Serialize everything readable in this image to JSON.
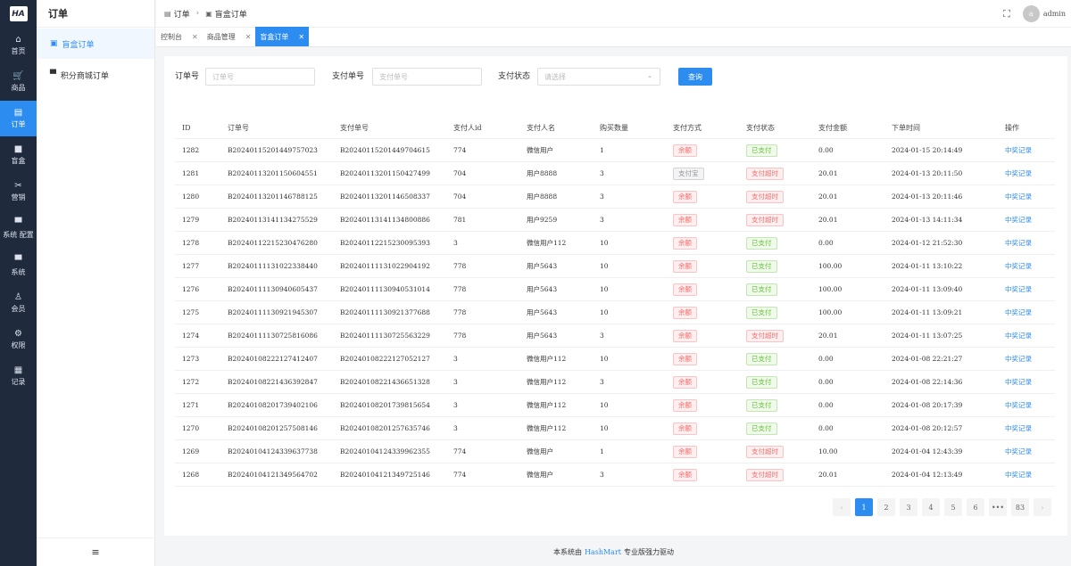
{
  "rail": {
    "logo": "HA",
    "items": [
      {
        "label": "首页",
        "icon": "home-icon",
        "glyph": "⌂"
      },
      {
        "label": "商品",
        "icon": "cart-icon",
        "glyph": "🛒"
      },
      {
        "label": "订单",
        "icon": "order-icon",
        "glyph": "▤"
      },
      {
        "label": "盲盒",
        "icon": "box-icon",
        "glyph": "■"
      },
      {
        "label": "营销",
        "icon": "marketing-icon",
        "glyph": "✂"
      },
      {
        "label": "系统 配置",
        "icon": "config-icon",
        "glyph": "▀"
      },
      {
        "label": "系统",
        "icon": "system-icon",
        "glyph": "▀"
      },
      {
        "label": "会员",
        "icon": "member-icon",
        "glyph": "♙"
      },
      {
        "label": "权限",
        "icon": "permission-icon",
        "glyph": "⚙"
      },
      {
        "label": "记录",
        "icon": "record-icon",
        "glyph": "▦"
      }
    ]
  },
  "subnav": {
    "title": "订单",
    "items": [
      {
        "label": "盲盒订单",
        "glyph": "▣"
      },
      {
        "label": "积分商城订单",
        "glyph": "▀"
      }
    ],
    "footer_glyph": "≡"
  },
  "header": {
    "crumbs": [
      "订单",
      "盲盒订单"
    ],
    "fullscreen_glyph": "⛶",
    "avatar_letter": "a",
    "username": "admin"
  },
  "tabs": [
    {
      "label": "控制台"
    },
    {
      "label": "商品管理"
    },
    {
      "label": "盲盒订单"
    }
  ],
  "filters": {
    "order_no_label": "订单号",
    "order_no_placeholder": "订单号",
    "pay_no_label": "支付单号",
    "pay_no_placeholder": "支付单号",
    "pay_status_label": "支付状态",
    "pay_status_placeholder": "请选择",
    "query_label": "查询"
  },
  "table": {
    "columns": [
      "ID",
      "订单号",
      "支付单号",
      "支付人id",
      "支付人名",
      "购买数量",
      "支付方式",
      "支付状态",
      "支付金额",
      "下单时间",
      "操作"
    ],
    "rows": [
      [
        "1282",
        "B202401152014497570​23",
        "B202401152014497046​15",
        "774",
        "微信用户",
        "1",
        "余额",
        "已支付",
        "0.00",
        "2024-01-15 20:14:49",
        "中奖记录"
      ],
      [
        "1281",
        "B202401132011506045​51",
        "B202401132011504274​99",
        "704",
        "用户8888",
        "3",
        "支付宝",
        "支付超时",
        "20.01",
        "2024-01-13 20:11:50",
        "中奖记录"
      ],
      [
        "1280",
        "B202401132011467881​25",
        "B202401132011465083​37",
        "704",
        "用户8888",
        "3",
        "余额",
        "支付超时",
        "20.01",
        "2024-01-13 20:11:46",
        "中奖记录"
      ],
      [
        "1279",
        "B202401131411342755​29",
        "B202401131411348008​86",
        "781",
        "用户9259",
        "3",
        "余额",
        "支付超时",
        "20.01",
        "2024-01-13 14:11:34",
        "中奖记录"
      ],
      [
        "1278",
        "B202401122152304762​80",
        "B202401122152300953​93",
        "3",
        "微信用户112",
        "10",
        "余额",
        "已支付",
        "0.00",
        "2024-01-12 21:52:30",
        "中奖记录"
      ],
      [
        "1277",
        "B202401111310223384​40",
        "B202401111310229041​92",
        "778",
        "用户5643",
        "10",
        "余额",
        "已支付",
        "100.00",
        "2024-01-11 13:10:22",
        "中奖记录"
      ],
      [
        "1276",
        "B202401111309406054​37",
        "B202401111309405310​14",
        "778",
        "用户5643",
        "10",
        "余额",
        "已支付",
        "100.00",
        "2024-01-11 13:09:40",
        "中奖记录"
      ],
      [
        "1275",
        "B202401111309219453​07",
        "B202401111309213776​88",
        "778",
        "用户5643",
        "10",
        "余额",
        "已支付",
        "100.00",
        "2024-01-11 13:09:21",
        "中奖记录"
      ],
      [
        "1274",
        "B202401111307258160​86",
        "B202401111307255632​29",
        "778",
        "用户5643",
        "3",
        "余额",
        "支付超时",
        "20.01",
        "2024-01-11 13:07:25",
        "中奖记录"
      ],
      [
        "1273",
        "B202401082221274124​07",
        "B202401082221270521​27",
        "3",
        "微信用户112",
        "10",
        "余额",
        "已支付",
        "0.00",
        "2024-01-08 22:21:27",
        "中奖记录"
      ],
      [
        "1272",
        "B202401082214363928​47",
        "B202401082214366513​28",
        "3",
        "微信用户112",
        "3",
        "余额",
        "已支付",
        "0.00",
        "2024-01-08 22:14:36",
        "中奖记录"
      ],
      [
        "1271",
        "B202401082017394021​06",
        "B202401082017398156​54",
        "3",
        "微信用户112",
        "10",
        "余额",
        "已支付",
        "0.00",
        "2024-01-08 20:17:39",
        "中奖记录"
      ],
      [
        "1270",
        "B202401082012575081​46",
        "B202401082012576357​46",
        "3",
        "微信用户112",
        "10",
        "余额",
        "已支付",
        "0.00",
        "2024-01-08 20:12:57",
        "中奖记录"
      ],
      [
        "1269",
        "B202401041243396377​38",
        "B202401041243399623​55",
        "774",
        "微信用户",
        "1",
        "余额",
        "支付超时",
        "10.00",
        "2024-01-04 12:43:39",
        "中奖记录"
      ],
      [
        "1268",
        "B202401041213495647​02",
        "B202401041213497251​46",
        "774",
        "微信用户",
        "3",
        "余额",
        "支付超时",
        "20.01",
        "2024-01-04 12:13:49",
        "中奖记录"
      ]
    ]
  },
  "pager": {
    "prev": "‹",
    "pages": [
      "1",
      "2",
      "3",
      "4",
      "5",
      "6",
      "•••",
      "83"
    ],
    "next": "›",
    "current": "1"
  },
  "footer": {
    "prefix": "本系统由",
    "brand": "HashMart",
    "suffix": "专业版强力驱动"
  },
  "colors": {
    "accent": "#2d8cf0",
    "rail_bg": "#1f2a3d",
    "danger": "#f56c6c",
    "success": "#67c23a"
  }
}
